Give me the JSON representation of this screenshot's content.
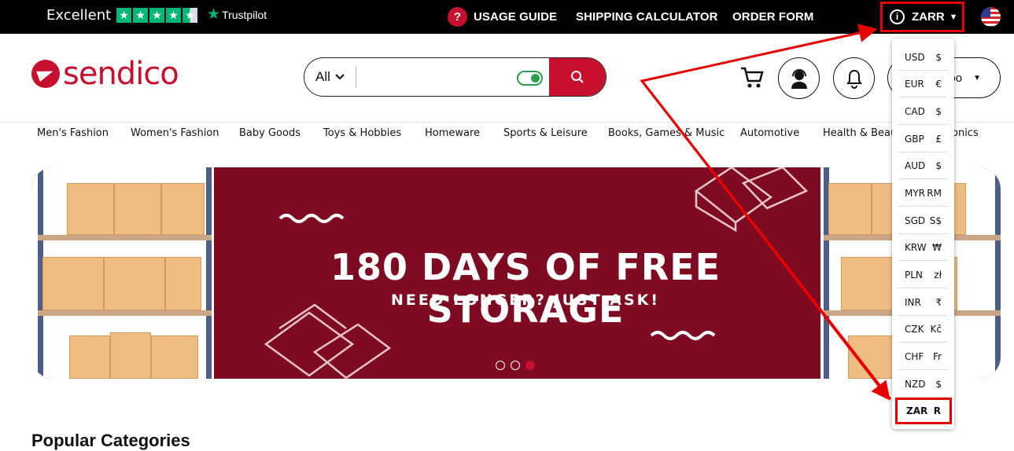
{
  "topbar": {
    "trustpilot_rating_text": "Excellent",
    "trustpilot_stars": 4.5,
    "trustpilot_brand": "Trustpilot",
    "usage_guide": "USAGE GUIDE",
    "shipping_calculator": "SHIPPING CALCULATOR",
    "order_form": "ORDER FORM",
    "currency_selected": "ZARR",
    "help_icon_char": "?",
    "flag": "us-flag-icon"
  },
  "header": {
    "logo_text": "sendico",
    "search": {
      "category": "All",
      "value": "",
      "toggle_on": true
    },
    "account_label": "bo"
  },
  "categories": [
    "Men's Fashion",
    "Women's Fashion",
    "Baby Goods",
    "Toys & Hobbies",
    "Homeware",
    "Sports & Leisure",
    "Books, Games & Music",
    "Automotive",
    "Health & Beauty",
    "onics"
  ],
  "banner": {
    "title": "180 DAYS OF FREE STORAGE",
    "subtitle": "NEED LONGER? JUST ASK!",
    "slides": 3,
    "active_slide": 3
  },
  "section_title": "Popular Categories",
  "currency_menu": [
    {
      "code": "USD",
      "symbol": "$"
    },
    {
      "code": "EUR",
      "symbol": "€"
    },
    {
      "code": "CAD",
      "symbol": "$"
    },
    {
      "code": "GBP",
      "symbol": "£"
    },
    {
      "code": "AUD",
      "symbol": "$"
    },
    {
      "code": "MYR",
      "symbol": "RM"
    },
    {
      "code": "SGD",
      "symbol": "S$"
    },
    {
      "code": "KRW",
      "symbol": "₩"
    },
    {
      "code": "PLN",
      "symbol": "zł"
    },
    {
      "code": "INR",
      "symbol": "₹"
    },
    {
      "code": "CZK",
      "symbol": "Kč"
    },
    {
      "code": "CHF",
      "symbol": "Fr"
    },
    {
      "code": "NZD",
      "symbol": "$"
    },
    {
      "code": "ZAR",
      "symbol": "R",
      "selected": true
    }
  ],
  "colors": {
    "brand": "#c8102e",
    "banner": "#7e0b21",
    "annotation": "#e60000",
    "trustpilot": "#00b67a"
  }
}
